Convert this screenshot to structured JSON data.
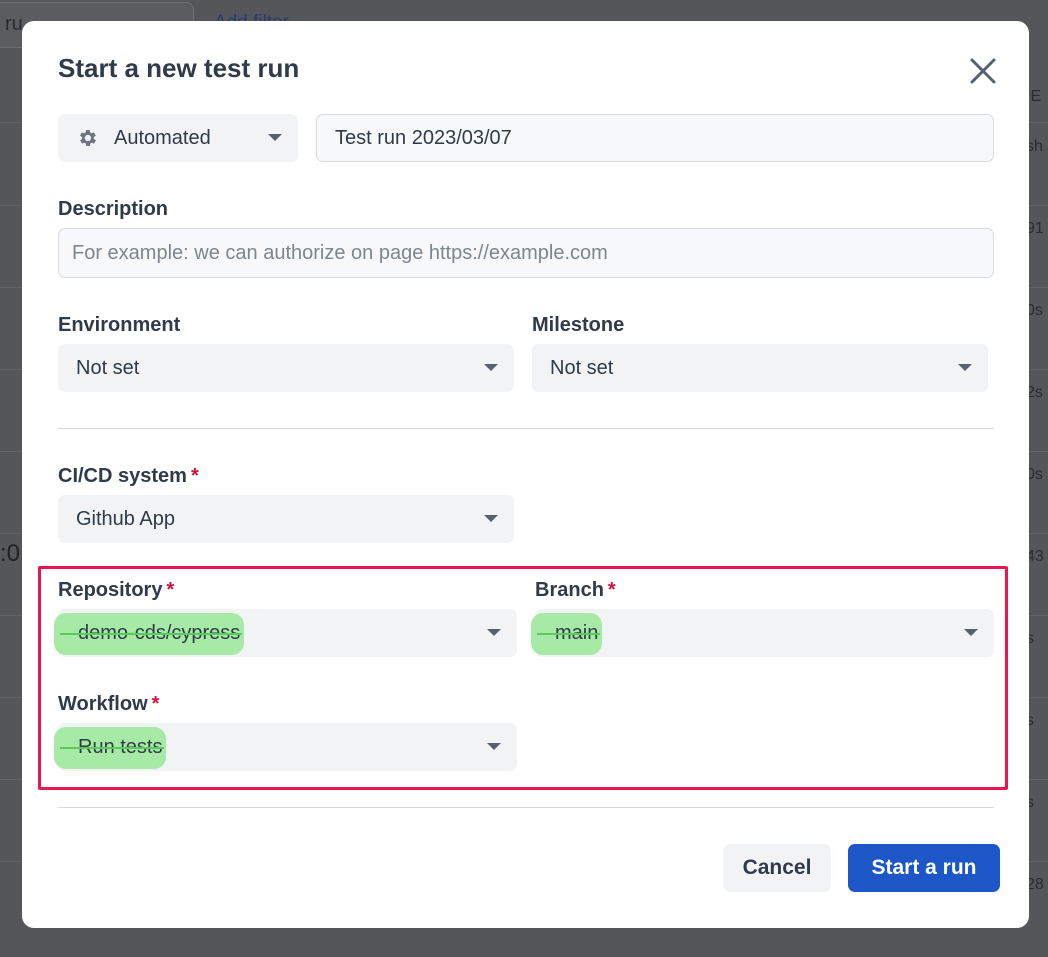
{
  "background": {
    "search_fragment": "ru",
    "add_filter": "Add filter",
    "edge_texts": [
      "IE",
      "sh",
      "91",
      "0s",
      "2s",
      "0s",
      "43",
      "s",
      "s",
      "s",
      "28"
    ],
    "left_edge_text": ":0"
  },
  "dialog": {
    "title": "Start a new test run",
    "close_label": "×",
    "run_type": {
      "icon": "gear-icon",
      "value": "Automated"
    },
    "run_name": "Test run 2023/03/07",
    "description": {
      "label": "Description",
      "placeholder": "For example: we can authorize on page https://example.com"
    },
    "environment": {
      "label": "Environment",
      "value": "Not set"
    },
    "milestone": {
      "label": "Milestone",
      "value": "Not set"
    },
    "cicd": {
      "label": "CI/CD system",
      "required": "*",
      "value": "Github App"
    },
    "repository": {
      "label": "Repository",
      "required": "*",
      "value": "demo-cds/cypress"
    },
    "branch": {
      "label": "Branch",
      "required": "*",
      "value": "main"
    },
    "workflow": {
      "label": "Workflow",
      "required": "*",
      "value": "Run tests"
    },
    "buttons": {
      "cancel": "Cancel",
      "start": "Start a run"
    }
  },
  "colors": {
    "primary": "#1d57c7",
    "required": "#d0103a",
    "highlight_box": "#e8174f",
    "highlight_marker": "#a6eaa6"
  }
}
